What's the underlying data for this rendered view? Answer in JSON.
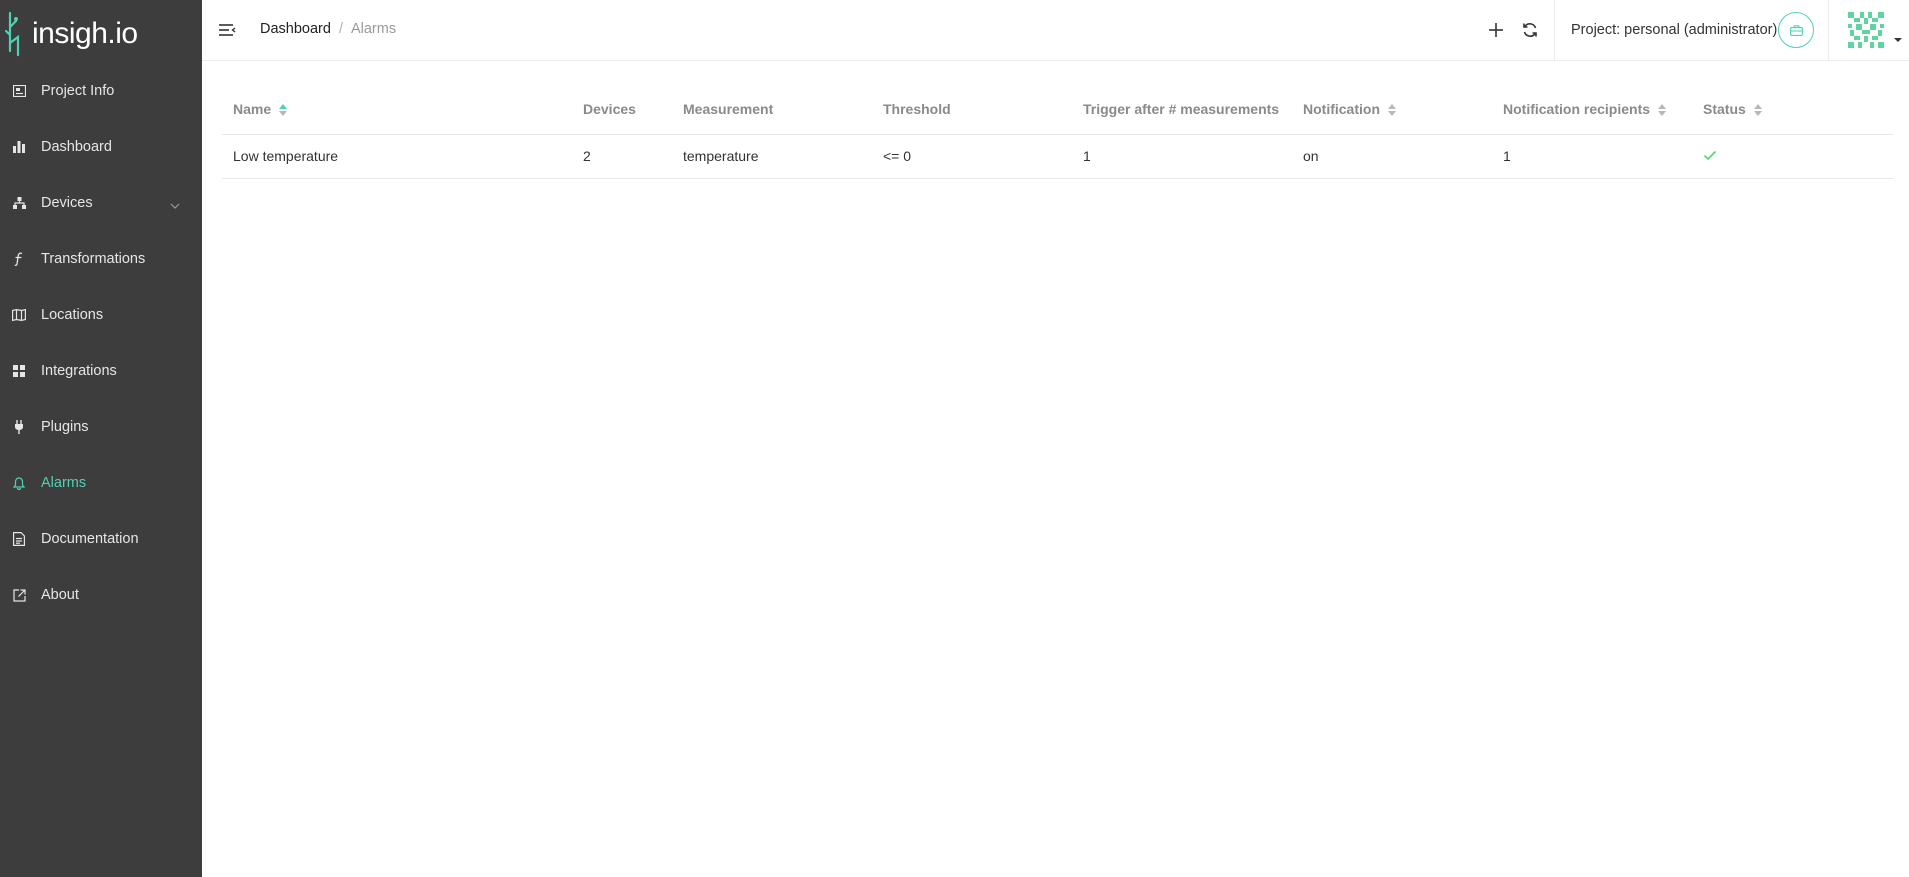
{
  "app": {
    "logo_text": "insigh.io"
  },
  "sidebar": {
    "items": [
      {
        "label": "Project Info",
        "icon": "project-info-icon"
      },
      {
        "label": "Dashboard",
        "icon": "bar-chart-icon"
      },
      {
        "label": "Devices",
        "icon": "devices-tree-icon",
        "has_submenu": true
      },
      {
        "label": "Transformations",
        "icon": "function-icon"
      },
      {
        "label": "Locations",
        "icon": "map-icon"
      },
      {
        "label": "Integrations",
        "icon": "grid-icon"
      },
      {
        "label": "Plugins",
        "icon": "plug-icon"
      },
      {
        "label": "Alarms",
        "icon": "bell-icon",
        "active": true
      },
      {
        "label": "Documentation",
        "icon": "document-icon"
      },
      {
        "label": "About",
        "icon": "external-link-icon"
      }
    ]
  },
  "header": {
    "breadcrumb": {
      "root": "Dashboard",
      "separator": "/",
      "current": "Alarms"
    },
    "project_label": "Project: personal (administrator)"
  },
  "table": {
    "columns": [
      {
        "label": "Name",
        "sortable": true,
        "sort": "asc"
      },
      {
        "label": "Devices",
        "sortable": false
      },
      {
        "label": "Measurement",
        "sortable": false
      },
      {
        "label": "Threshold",
        "sortable": false
      },
      {
        "label": "Trigger after # measurements",
        "sortable": false
      },
      {
        "label": "Notification",
        "sortable": true
      },
      {
        "label": "Notification recipients",
        "sortable": true
      },
      {
        "label": "Status",
        "sortable": true
      }
    ],
    "rows": [
      {
        "name": "Low temperature",
        "devices": "2",
        "measurement": "temperature",
        "threshold": "<= 0",
        "trigger": "1",
        "notification": "on",
        "recipients": "1",
        "status": "check-icon"
      }
    ]
  },
  "colors": {
    "accent": "#4fd1b5",
    "sidebar_bg": "#3d3d3d",
    "status_ok": "#4cd964"
  }
}
